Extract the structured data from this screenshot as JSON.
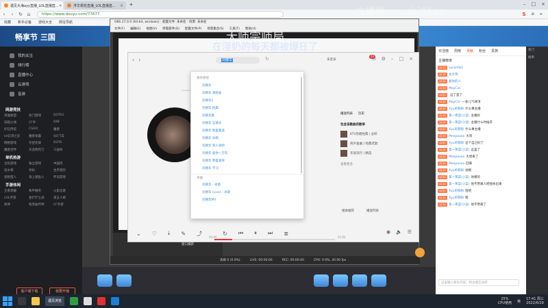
{
  "browser": {
    "tabs": [
      {
        "label": "遇见大海ayy直播_LOL直播直..."
      },
      {
        "label": "浮华桐花直播_LOL直播直..."
      }
    ],
    "url": "https://www.douyu.com/77677",
    "bookmarks": [
      "收藏",
      "新手必备",
      "游戏大全",
      "网址导航"
    ]
  },
  "watermarks": {
    "top_line": "大师宗师局",
    "sub_line": "在淫奶的每天都被爆狂了",
    "right_faded": "主播榜 一…么过Xue"
  },
  "douyu": {
    "logo": "畅享节 三国",
    "sidebar_items": [
      "我的关注",
      "排行榜",
      "直播中心",
      "云游戏",
      "音游"
    ],
    "section_hot": "网游竞技",
    "hot_games": [
      "英雄联盟",
      "热门游戏",
      "DOTA2",
      "穿越火线",
      "CF手",
      "DNF",
      "炉石传说",
      "CSGO",
      "魔兽",
      "lol云顶之弈",
      "魔兽争霸",
      "QQ飞车",
      "网络游戏",
      "守望先锋",
      "DOTA",
      "魔兽世界",
      "天涯明月刀",
      "三国杀"
    ],
    "section_single": "单机热游",
    "single_games": [
      "主机游戏",
      "独立游戏",
      "中国风",
      "逆水寒",
      "单机",
      "生存冒险",
      "怪物猎人",
      "海上捕鱼人",
      "怀旧游戏"
    ],
    "section_mobile": "手游休闲",
    "mobile_games": [
      "王者荣耀",
      "和平精英",
      "火影忍者",
      "LOL手游",
      "金铲铲之战",
      "第五人格",
      "原神",
      "暗黑破坏神",
      "CF手游"
    ],
    "btn_download": "客户端下载",
    "btn_open": "我要开播"
  },
  "obs": {
    "title": "OBS 27.0.0 (64-bit, windows) - 配置文件: 未命名 - 场景: 未命名",
    "menu": [
      "文件(F)",
      "编辑(E)",
      "视图(V)",
      "停靠部件(D)",
      "配置文件(P)",
      "场景集合(S)",
      "工具(T)",
      "帮助(H)"
    ],
    "status": [
      "丢帧 0 (0.0%)",
      "LIVE: 00:00:00",
      "REC: 00:00:00",
      "CPU: 0.9%, 30.00 fps"
    ],
    "scene_label": "窗口捕获"
  },
  "player": {
    "search_text": "刘德华",
    "login_text": "未登录",
    "badge": "10",
    "dropdown_head": "猜你想搜",
    "suggestions": [
      "刘德华",
      "刘德华 演唱会",
      "刘德华2",
      "刘德华 经典",
      "刘德华歌",
      "刘德华 忘情水",
      "刘德华 暗里着迷",
      "刘德华 冰雨",
      "刘德华 男人哭吧",
      "刘德华 爱你一万年",
      "刘德华 恭喜发财",
      "刘德华 学习"
    ],
    "dropdown_sep": "单曲",
    "extra_results": [
      "刘德华 - 冰雨",
      "刘德华 (Live) - 冰雨",
      "刘德华MV"
    ],
    "side_head_a": "播放列表",
    "side_head_b": "历史",
    "side_title": "包含该歌曲的歌单",
    "side_rows": [
      "KTV热唱经典 | 必听",
      "男声金曲 | 经典老歌",
      "华语流行 | 精选"
    ],
    "side_empty": "查看更多",
    "bottom_a": "相关推荐",
    "bottom_b": "播放列表",
    "time_a": "00:00",
    "time_b": "03:00",
    "progress": 0.15
  },
  "chat": {
    "tabs": [
      "日活榜",
      "周榜",
      "贡献",
      "粉丝",
      "贵族"
    ],
    "header": "主播榜单",
    "rows": [
      {
        "lvl": "LV.10",
        "name": "LonzrOk1",
        "msg": ""
      },
      {
        "lvl": "LV.10",
        "name": "木大哥",
        "msg": ""
      },
      {
        "lvl": "LV.10",
        "name": "爱你的人",
        "msg": ""
      },
      {
        "lvl": "LV.10",
        "name": "MayCici",
        "msg": ""
      },
      {
        "lvl": "LV.47",
        "name": "",
        "msg": "这了是了"
      },
      {
        "lvl": "LV.47",
        "name": "MayCici",
        "msg": "一会儿气球顶"
      },
      {
        "lvl": "LV.47",
        "name": "Xyu的铁粉",
        "msg": "什么事主播"
      },
      {
        "lvl": "LV.14",
        "name": "第一茶菜(小菜)",
        "msg": "主播好"
      },
      {
        "lvl": "LV.14",
        "name": "第一茶菜(小菜)",
        "msg": "主播什么时候开"
      },
      {
        "lvl": "LV.47",
        "name": "Xyu的铁粉",
        "msg": "什么事主播"
      },
      {
        "lvl": "LV.10",
        "name": "Meepoooo",
        "msg": "大哥"
      },
      {
        "lvl": "LV.47",
        "name": "Xyu的铁粉",
        "msg": "这个自己好了"
      },
      {
        "lvl": "LV.14",
        "name": "第一茶菜(小菜)",
        "msg": "这里了"
      },
      {
        "lvl": "LV.10",
        "name": "Meepoooo",
        "msg": "大佬来了"
      },
      {
        "lvl": "LV.10",
        "name": "Meepoooo",
        "msg": "回来"
      },
      {
        "lvl": "LV.47",
        "name": "Xyu的铁粉",
        "msg": "他啊"
      },
      {
        "lvl": "LV.14",
        "name": "第一茶菜(小菜)",
        "msg": "你哪的"
      },
      {
        "lvl": "LV.14",
        "name": "第一茶菜(小菜)",
        "msg": "他不用来人把他杀出来"
      },
      {
        "lvl": "LV.47",
        "name": "Xyu的铁粉",
        "msg": "哈哈"
      },
      {
        "lvl": "LV.47",
        "name": "Xyu的铁粉",
        "msg": "嗯"
      },
      {
        "lvl": "LV.14",
        "name": "第一茶菜(小菜)",
        "msg": "他不用来了"
      }
    ],
    "input_placeholder": "这里输入聊天内容，和主播互动吧"
  },
  "taskbar": {
    "browser_label": "遇见浏览",
    "cpu_pct": "25%",
    "cpu_label": "CPU使用",
    "time": "17:41 周三",
    "date": "2022/6/29",
    "lang": "英"
  }
}
